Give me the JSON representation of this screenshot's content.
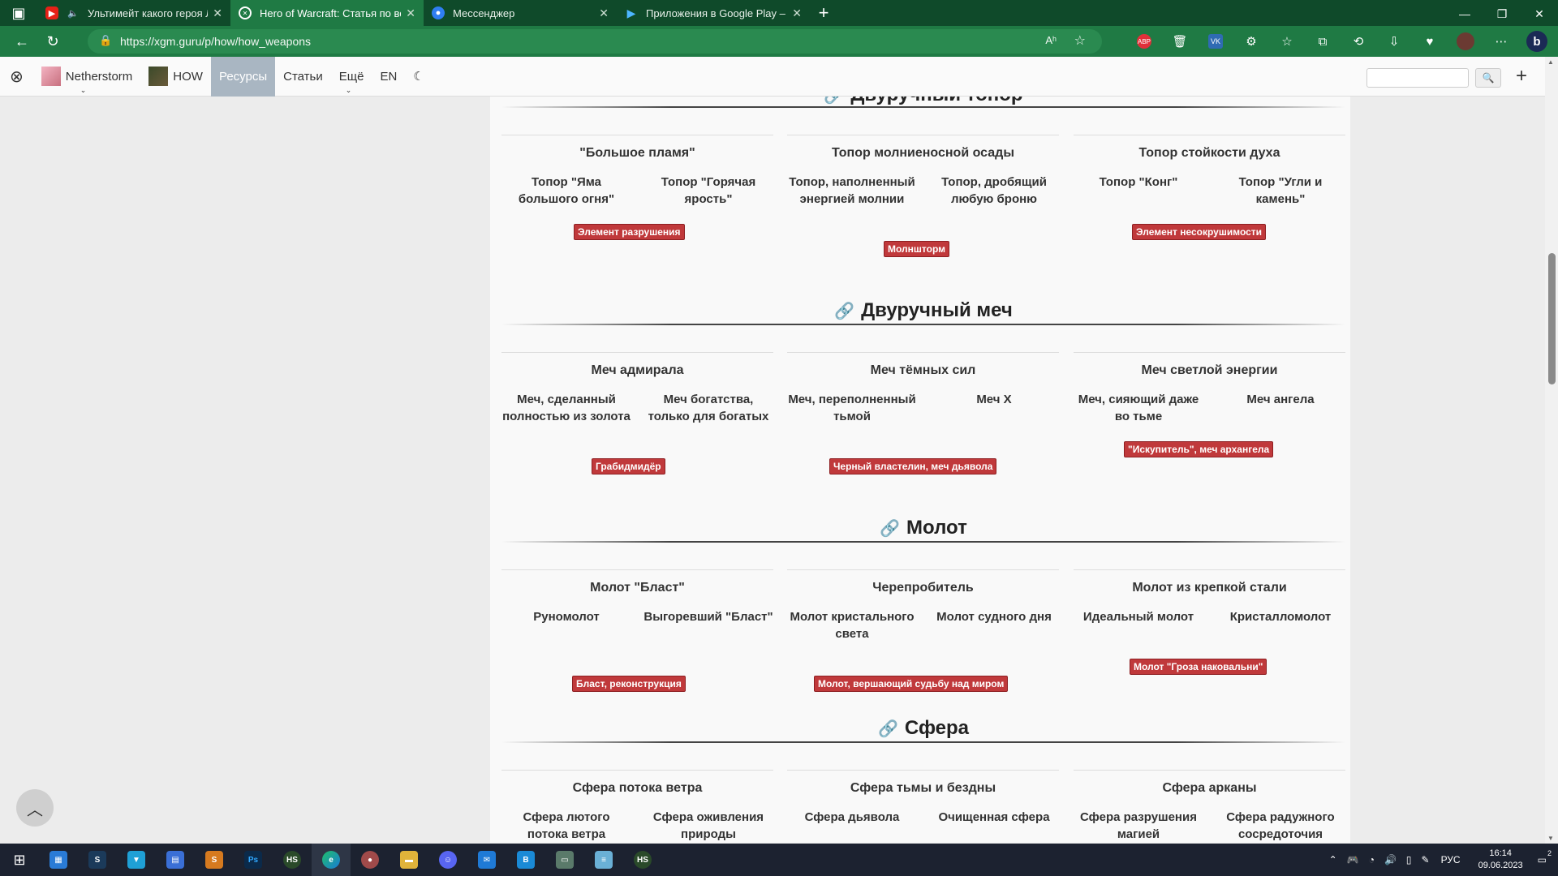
{
  "browser": {
    "tabs": [
      {
        "title": "Ультимейт какого героя Л",
        "icon": "youtube-icon"
      },
      {
        "title": "Hero of Warcraft: Статья по все",
        "icon": "site-icon",
        "active": true
      },
      {
        "title": "Мессенджер",
        "icon": "messenger-icon"
      },
      {
        "title": "Приложения в Google Play – Ex",
        "icon": "google-play-icon"
      }
    ],
    "url": "https://xgm.guru/p/how/how_weapons",
    "url_host": "xgm.guru",
    "url_path": "/p/how/how_weapons",
    "reader_label": "Aʰ"
  },
  "sitenav": {
    "items": [
      "Netherstorm",
      "HOW",
      "Ресурсы",
      "Статьи",
      "Ещё",
      "EN"
    ],
    "active": "Ресурсы",
    "search_placeholder": ""
  },
  "sections": [
    {
      "title": "Двуручный топор",
      "columns": [
        {
          "heading": "\"Большое пламя\"",
          "subs": [
            "Топор \"Яма большого огня\"",
            "Топор \"Горячая ярость\""
          ],
          "badge": "Элемент разрушения"
        },
        {
          "heading": "Топор молниеносной осады",
          "subs": [
            "Топор, наполненный энергией молнии",
            "Топор, дробящий любую броню"
          ],
          "badge": "Молншторм"
        },
        {
          "heading": "Топор стойкости духа",
          "subs": [
            "Топор \"Конг\"",
            "Топор \"Угли и камень\""
          ],
          "badge": "Элемент несокрушимости"
        }
      ]
    },
    {
      "title": "Двуручный меч",
      "columns": [
        {
          "heading": "Меч адмирала",
          "subs": [
            "Меч, сделанный полностью из золота",
            "Меч богатства, только для богатых"
          ],
          "badge": "Грабидмидёр"
        },
        {
          "heading": "Меч тёмных сил",
          "subs": [
            "Меч, переполненный тьмой",
            "Меч X"
          ],
          "badge": "Черный властелин, меч дьявола"
        },
        {
          "heading": "Меч светлой энергии",
          "subs": [
            "Меч, сияющий даже во тьме",
            "Меч ангела"
          ],
          "badge": "\"Искупитель\", меч архангела"
        }
      ]
    },
    {
      "title": "Молот",
      "columns": [
        {
          "heading": "Молот \"Бласт\"",
          "subs": [
            "Руномолот",
            "Выгоревший \"Бласт\""
          ],
          "badge": "Бласт, реконструкция"
        },
        {
          "heading": "Черепробитель",
          "subs": [
            "Молот кристального света",
            "Молот судного дня"
          ],
          "badge": "Молот, вершающий судьбу над миром"
        },
        {
          "heading": "Молот из крепкой стали",
          "subs": [
            "Идеальный молот",
            "Кристалломолот"
          ],
          "badge": "Молот \"Гроза наковальни\""
        }
      ]
    },
    {
      "title": "Сфера",
      "columns": [
        {
          "heading": "Сфера потока ветра",
          "subs": [
            "Сфера лютого потока ветра",
            "Сфера оживления природы"
          ],
          "badge": ""
        },
        {
          "heading": "Сфера тьмы и бездны",
          "subs": [
            "Сфера дьявола",
            "Очищенная сфера"
          ],
          "badge": ""
        },
        {
          "heading": "Сфера арканы",
          "subs": [
            "Сфера разрушения магией",
            "Сфера радужного сосредоточия"
          ],
          "badge": ""
        }
      ]
    }
  ],
  "taskbar": {
    "lang": "РУС",
    "time": "16:14",
    "date": "09.06.2023",
    "notifications": "2"
  },
  "colors": {
    "tabbar": "#0f4a2a",
    "toolbar": "#1f7a44",
    "badge": "#c0393b",
    "nav_active": "#a9b6c2"
  }
}
